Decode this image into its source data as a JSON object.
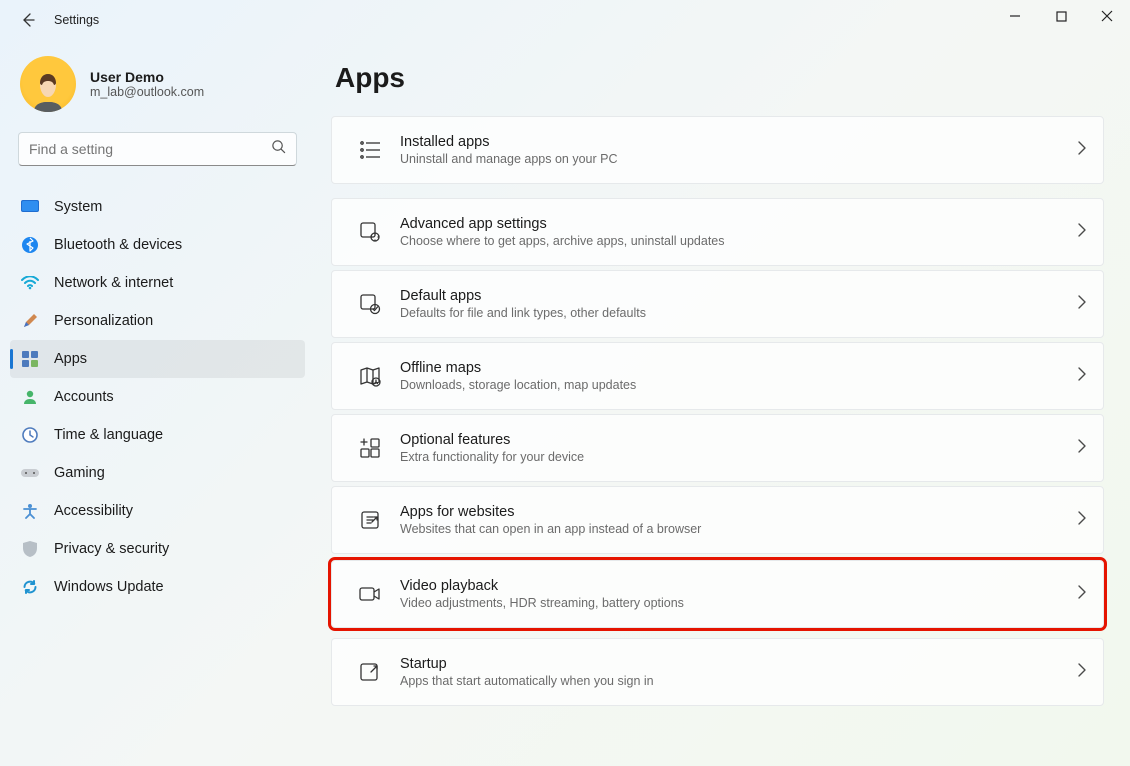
{
  "window": {
    "title": "Settings"
  },
  "user": {
    "name": "User Demo",
    "email": "m_lab@outlook.com"
  },
  "search": {
    "placeholder": "Find a setting"
  },
  "nav": {
    "items": [
      {
        "label": "System"
      },
      {
        "label": "Bluetooth & devices"
      },
      {
        "label": "Network & internet"
      },
      {
        "label": "Personalization"
      },
      {
        "label": "Apps"
      },
      {
        "label": "Accounts"
      },
      {
        "label": "Time & language"
      },
      {
        "label": "Gaming"
      },
      {
        "label": "Accessibility"
      },
      {
        "label": "Privacy & security"
      },
      {
        "label": "Windows Update"
      }
    ]
  },
  "page": {
    "title": "Apps"
  },
  "cards": [
    {
      "title": "Installed apps",
      "sub": "Uninstall and manage apps on your PC"
    },
    {
      "title": "Advanced app settings",
      "sub": "Choose where to get apps, archive apps, uninstall updates"
    },
    {
      "title": "Default apps",
      "sub": "Defaults for file and link types, other defaults"
    },
    {
      "title": "Offline maps",
      "sub": "Downloads, storage location, map updates"
    },
    {
      "title": "Optional features",
      "sub": "Extra functionality for your device"
    },
    {
      "title": "Apps for websites",
      "sub": "Websites that can open in an app instead of a browser"
    },
    {
      "title": "Video playback",
      "sub": "Video adjustments, HDR streaming, battery options"
    },
    {
      "title": "Startup",
      "sub": "Apps that start automatically when you sign in"
    }
  ]
}
